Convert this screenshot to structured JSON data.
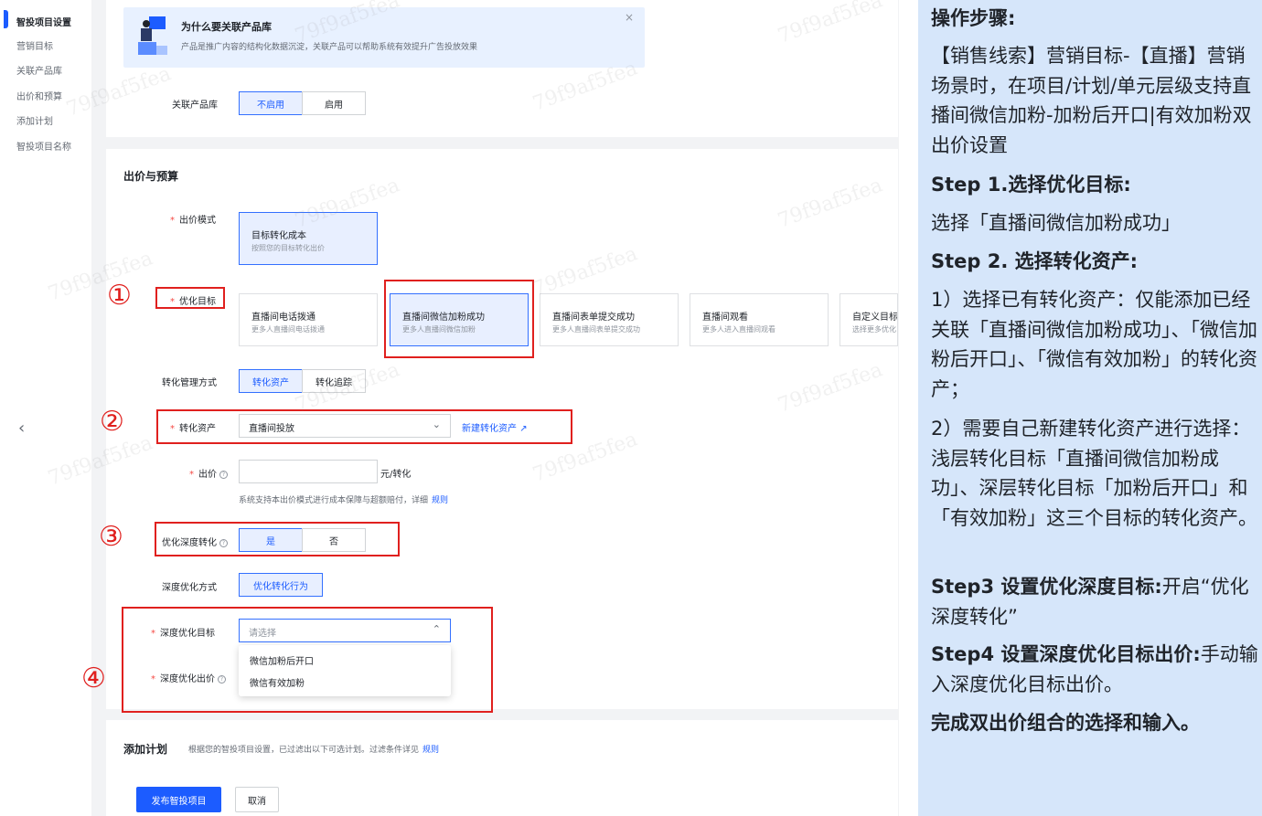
{
  "nav": {
    "items": [
      "智投项目设置",
      "营销目标",
      "关联产品库",
      "出价和预算",
      "添加计划",
      "智投项目名称"
    ]
  },
  "banner": {
    "title": "为什么要关联产品库",
    "desc": "产品是推广内容的结构化数据沉淀，关联产品可以帮助系统有效提升广告投放效果",
    "close": "×"
  },
  "product_lib": {
    "label": "关联产品库",
    "options": [
      "不启用",
      "启用"
    ],
    "selected": "不启用"
  },
  "bidding": {
    "section_title": "出价与预算",
    "bid_mode_label": "出价模式",
    "bid_mode_card": {
      "title": "目标转化成本",
      "desc": "按照您的目标转化出价"
    },
    "goal_label": "优化目标",
    "goals": [
      {
        "title": "直播间电话拨通",
        "desc": "更多人直播间电话拨通"
      },
      {
        "title": "直播间微信加粉成功",
        "desc": "更多人直播间微信加粉"
      },
      {
        "title": "直播间表单提交成功",
        "desc": "更多人直播间表单提交成功"
      },
      {
        "title": "直播间观看",
        "desc": "更多人进入直播间观看"
      },
      {
        "title": "自定义目标",
        "desc": "选择更多优化目标"
      }
    ],
    "selected_goal": "直播间微信加粉成功",
    "conv_mgmt_label": "转化管理方式",
    "conv_mgmt_options": [
      "转化资产",
      "转化追踪"
    ],
    "conv_asset_label": "转化资产",
    "conv_asset_value": "直播间投放",
    "new_asset_link": "新建转化资产",
    "bid_label": "出价",
    "bid_unit": "元/转化",
    "bid_hint": "系统支持本出价模式进行成本保障与超额赔付，详细",
    "bid_hint_link": "规则",
    "deep_conv_label": "优化深度转化",
    "deep_conv_options": [
      "是",
      "否"
    ],
    "deep_mode_label": "深度优化方式",
    "deep_mode_value": "优化转化行为",
    "deep_goal_label": "深度优化目标",
    "deep_goal_placeholder": "请选择",
    "deep_goal_options": [
      "微信加粉后开口",
      "微信有效加粉"
    ],
    "deep_bid_label": "深度优化出价"
  },
  "add_plan": {
    "title": "添加计划",
    "desc": "根据您的智投项目设置，已过滤出以下可选计划。过滤条件详见",
    "link": "规则"
  },
  "footer": {
    "publish": "发布智投项目",
    "cancel": "取消"
  },
  "markers": [
    "①",
    "②",
    "③",
    "④"
  ],
  "watermark": "79f9af5fea",
  "panel": {
    "heading": "操作步骤:",
    "intro": "【销售线索】营销目标-【直播】营销场景时，在项目/计划/单元层级支持直播间微信加粉-加粉后开口|有效加粉双出价设置",
    "step1_title": "Step 1.选择优化目标:",
    "step1_text": "选择「直播间微信加粉成功」",
    "step2_title": "Step 2. 选择转化资产:",
    "step2_text1": "1）选择已有转化资产：仅能添加已经关联「直播间微信加粉成功」、「微信加粉后开口」、「微信有效加粉」的转化资产；",
    "step2_text2": "2）需要自己新建转化资产进行选择：浅层转化目标「直播间微信加粉成功」、深层转化目标「加粉后开口」和「有效加粉」这三个目标的转化资产。",
    "step3_title": "Step3 设置优化深度目标:",
    "step3_text": "开启“优化深度转化”",
    "step4_title": "Step4 设置深度优化目标出价:",
    "step4_text": "手动输入深度优化目标出价。",
    "done": "完成双出价组合的选择和输入。"
  },
  "colors": {
    "accent": "#1c5cff",
    "annotation_red": "#e0201e",
    "panel_bg": "#d6e6fa"
  }
}
